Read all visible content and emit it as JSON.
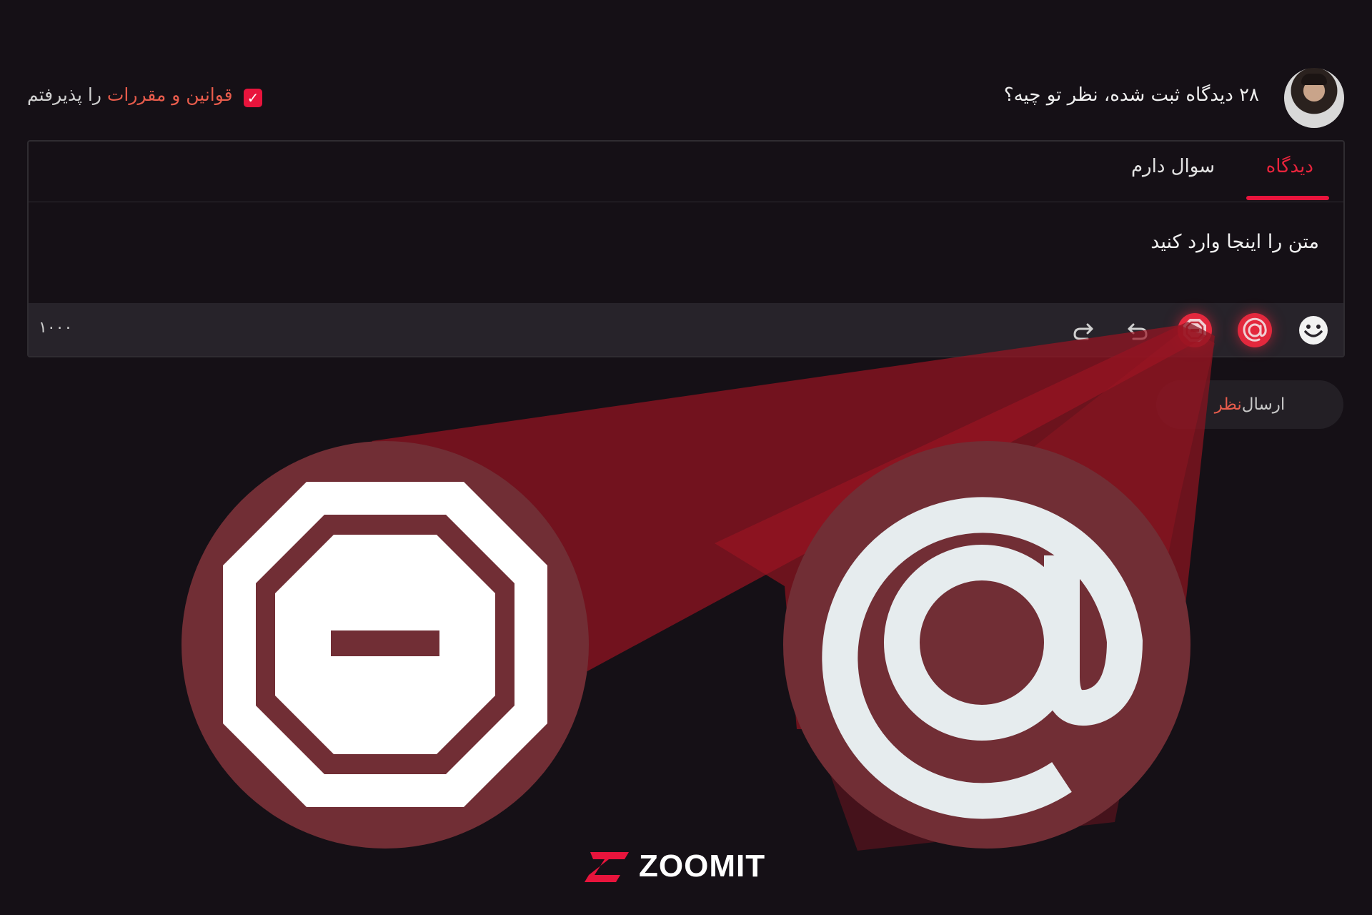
{
  "header": {
    "comment_count_text": "۲۸ دیدگاه ثبت شده، نظر تو چیه؟",
    "terms": {
      "link_text": "قوانین و مقررات",
      "suffix_text": " را پذیرفتم",
      "checked": true
    }
  },
  "editor": {
    "tabs": [
      {
        "label": "دیدگاه",
        "active": true
      },
      {
        "label": "سوال دارم",
        "active": false
      }
    ],
    "input_text": "متن را اینجا وارد کنید",
    "char_count": "۱۰۰۰",
    "toolbar_icons": [
      "emoji-icon",
      "mention-at-icon",
      "spoiler-stop-icon",
      "undo-icon",
      "redo-icon"
    ]
  },
  "submit": {
    "label_part1": "ارسال",
    "label_part2": " نظر"
  },
  "brand": {
    "logo_text": "ZOOMIT",
    "accent_color": "#e8143c"
  }
}
